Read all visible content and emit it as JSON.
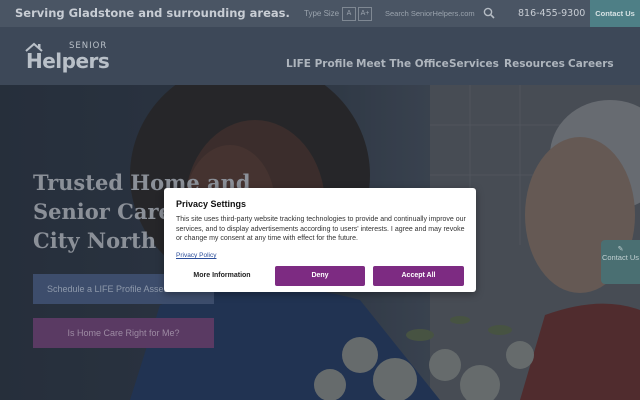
{
  "topbar": {
    "tagline": "Serving Gladstone and surrounding areas.",
    "type_size_label": "Type Size",
    "type_size_small": "A",
    "type_size_large": "A+",
    "search_placeholder": "Search SeniorHelpers.com",
    "phone": "816-455-9300",
    "contact_label": "Contact Us"
  },
  "logo": {
    "line1": "SENIOR",
    "line2": "Helpers"
  },
  "nav": {
    "items": [
      {
        "label": "LIFE Profile"
      },
      {
        "label": "Meet The Office"
      },
      {
        "label": "Services"
      },
      {
        "label": "Resources"
      },
      {
        "label": "Careers"
      }
    ]
  },
  "hero": {
    "title": "Trusted Home and Senior Care in Kansas City North",
    "schedule_button": "Schedule a LIFE Profile Assessment",
    "right_for_me_button": "Is Home Care Right for Me?",
    "contact_tab": "Contact Us"
  },
  "dialog": {
    "title": "Privacy Settings",
    "body": "This site uses third-party website tracking technologies to provide and continually improve our services, and to display advertisements according to users' interests. I agree and may revoke or change my consent at any time with effect for the future.",
    "privacy_link": "Privacy Policy",
    "more_info": "More Information",
    "deny": "Deny",
    "accept_all": "Accept All"
  },
  "colors": {
    "accent_purple": "#7d2b82",
    "teal": "#4e7f86",
    "header_bg": "#3d4858"
  }
}
